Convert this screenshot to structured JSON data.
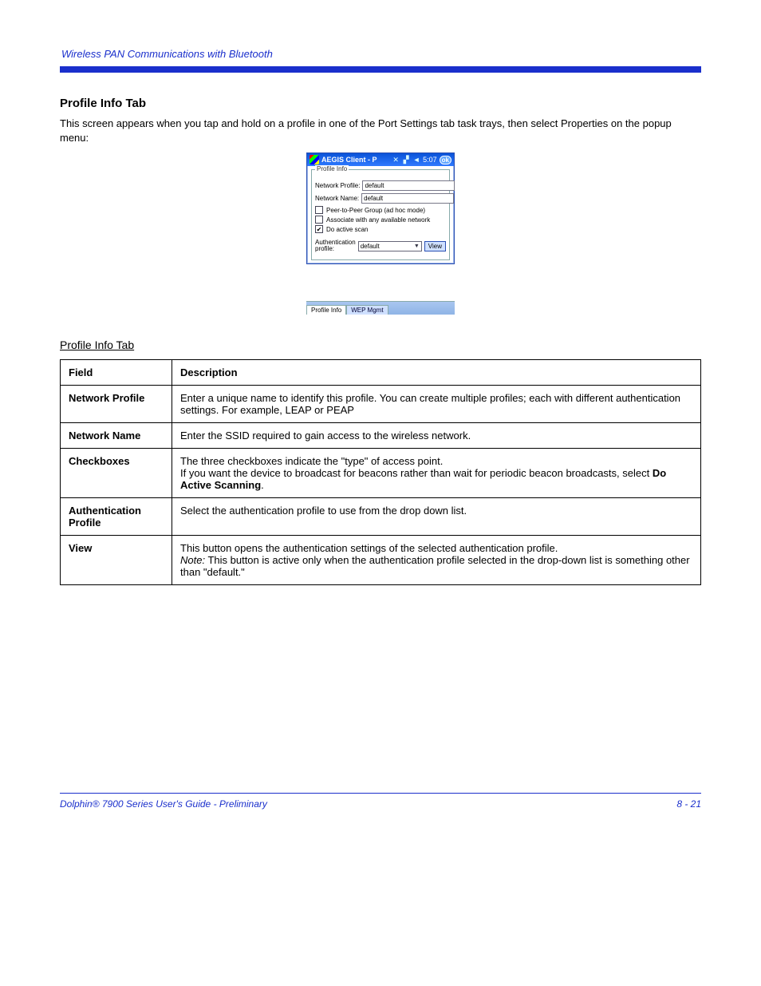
{
  "header": {
    "breadcrumb": "Wireless PAN Communications with Bluetooth"
  },
  "section": {
    "title": "Profile Info Tab",
    "intro": "This screen appears when you tap and hold on a profile in one of the Port Settings tab task trays, then select Properties on the popup menu:"
  },
  "window": {
    "title": "AEGIS Client - P",
    "clock": "5:07",
    "ok": "ok",
    "group_legend": "Profile Info",
    "network_profile_label": "Network Profile:",
    "network_profile_value": "default",
    "network_name_label": "Network Name:",
    "network_name_value": "default",
    "checks": {
      "p2p": "Peer-to-Peer Group (ad hoc mode)",
      "assoc": "Associate with any available network",
      "scan": "Do active scan"
    },
    "auth_label_line1": "Authentication",
    "auth_label_line2": "profile:",
    "auth_value": "default",
    "view": "View",
    "tabs": {
      "profile": "Profile Info",
      "wep": "WEP Mgmt"
    }
  },
  "table_heading": "Profile Info Tab",
  "table": {
    "cols": [
      "Field",
      "Description"
    ],
    "rows": [
      {
        "f": "Network Profile",
        "d": "Enter a unique name to identify this profile. You can create multiple profiles; each with different authentication settings. For example, LEAP or PEAP",
        "d2": ""
      },
      {
        "f": "Network Name",
        "d": "Enter the SSID required to gain access to the wireless network.",
        "d2": ""
      },
      {
        "f": "Checkboxes",
        "d": "The three checkboxes indicate the \"type\" of access point.",
        "d2": "If you want the device to broadcast for beacons rather than wait for periodic beacon broadcasts, select ",
        "bold": "Do Active Scanning",
        "tail": "."
      },
      {
        "f": "Authentication Profile",
        "d": "Select the authentication profile to use from the drop down list.",
        "d2": ""
      },
      {
        "f": "View",
        "d": "This button opens the authentication settings of the selected authentication profile.",
        "d2_i": "Note:",
        "d2": " This button is active only when the authentication profile selected in the drop-down list is something other than \"default.\""
      }
    ]
  },
  "footer": {
    "left": "Dolphin® 7900 Series User's Guide - Preliminary",
    "right": "8 - 21"
  }
}
